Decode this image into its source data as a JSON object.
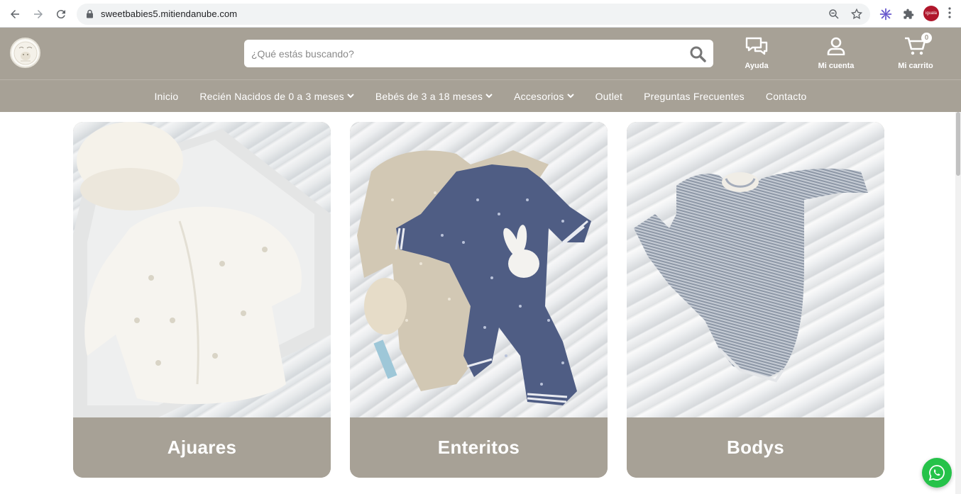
{
  "browser": {
    "url": "sweetbabies5.mitiendanube.com",
    "profile_label": "iguala"
  },
  "header": {
    "search_placeholder": "¿Qué estás buscando?",
    "help_label": "Ayuda",
    "account_label": "Mi cuenta",
    "cart_label": "Mi carrito",
    "cart_count": "0",
    "brand_color": "#a7a196"
  },
  "menu": {
    "items": [
      {
        "label": "Inicio",
        "has_dropdown": false
      },
      {
        "label": "Recién Nacidos de 0 a 3 meses",
        "has_dropdown": true
      },
      {
        "label": "Bebés de 3 a 18 meses",
        "has_dropdown": true
      },
      {
        "label": "Accesorios",
        "has_dropdown": true
      },
      {
        "label": "Outlet",
        "has_dropdown": false
      },
      {
        "label": "Preguntas Frecuentes",
        "has_dropdown": false
      },
      {
        "label": "Contacto",
        "has_dropdown": false
      }
    ]
  },
  "categories": [
    {
      "title": "Ajuares"
    },
    {
      "title": "Enteritos"
    },
    {
      "title": "Bodys"
    }
  ]
}
